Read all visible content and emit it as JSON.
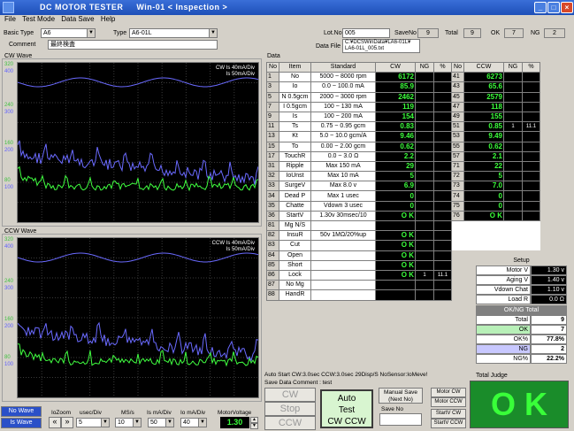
{
  "window": {
    "title": "DC MOTOR TESTER",
    "subtitle": "Win-01 < Inspection >"
  },
  "menu": [
    "File",
    "Test Mode",
    "Data Save",
    "Help"
  ],
  "header": {
    "basic_type_label": "Basic Type",
    "basic_type": "A6",
    "type_label": "Type",
    "type": "A6-01L",
    "comment_label": "Comment",
    "comment": "最終検査",
    "lotno_label": "Lot.No",
    "lotno": "005",
    "saveno_label": "SaveNo",
    "saveno": "9",
    "total_label": "Total",
    "total": "9",
    "ok_label": "OK",
    "ok": "7",
    "ng_label": "NG",
    "ng": "2",
    "datafile_label": "Data File",
    "datafile1": "C:¥DCSWinData¥LA6-01L¥",
    "datafile2": "LA6-01L_005.txt"
  },
  "cw_wave": {
    "title": "CW Wave",
    "legend1": "CW Is   40mA/Div",
    "legend2": "Is   50mA/Div",
    "y_labels": [
      "320",
      "400",
      "240",
      "300",
      "160",
      "200",
      "80",
      "100"
    ]
  },
  "ccw_wave": {
    "title": "CCW Wave",
    "legend1": "CCW Is   40mA/Div",
    "legend2": "Is   50mA/Div",
    "y_labels": [
      "320",
      "400",
      "240",
      "300",
      "160",
      "200",
      "80",
      "100"
    ]
  },
  "data_title": "Data",
  "table_headers": [
    "No",
    "Item",
    "Standard",
    "CW",
    "NG",
    "%",
    "No",
    "CCW",
    "NG",
    "%"
  ],
  "rows": [
    {
      "no": "1",
      "item": "No",
      "std": "5000 ~  8000 rpm",
      "cw": "6172",
      "ng": "",
      "pct": "",
      "no2": "41",
      "ccw": "6273",
      "ng2": "",
      "pct2": ""
    },
    {
      "no": "3",
      "item": "Io",
      "std": "0.0 ~ 100.0 mA",
      "cw": "85.9",
      "ng": "",
      "pct": "",
      "no2": "43",
      "ccw": "65.6",
      "ng2": "",
      "pct2": ""
    },
    {
      "no": "5",
      "item": "N 0.5gcm",
      "std": "2000 ~  3000 rpm",
      "cw": "2462",
      "ng": "",
      "pct": "",
      "no2": "45",
      "ccw": "2579",
      "ng2": "",
      "pct2": ""
    },
    {
      "no": "7",
      "item": "I 0.5gcm",
      "std": "100 ~   130 mA",
      "cw": "119",
      "ng": "",
      "pct": "",
      "no2": "47",
      "ccw": "118",
      "ng2": "",
      "pct2": ""
    },
    {
      "no": "9",
      "item": "Is",
      "std": "100 ~   200 mA",
      "cw": "154",
      "ng": "",
      "pct": "",
      "no2": "49",
      "ccw": "155",
      "ng2": "",
      "pct2": ""
    },
    {
      "no": "11",
      "item": "Ts",
      "std": "0.75 ~  0.95 gcm",
      "cw": "0.83",
      "ng": "",
      "pct": "",
      "no2": "51",
      "ccw": "0.85",
      "ng2": "1",
      "pct2": "11.1"
    },
    {
      "no": "13",
      "item": "Kt",
      "std": "5.0 ~  10.0 gcm/A",
      "cw": "9.46",
      "ng": "",
      "pct": "",
      "no2": "53",
      "ccw": "9.49",
      "ng2": "",
      "pct2": ""
    },
    {
      "no": "15",
      "item": "To",
      "std": "0.00 ~  2.00 gcm",
      "cw": "0.62",
      "ng": "",
      "pct": "",
      "no2": "55",
      "ccw": "0.62",
      "ng2": "",
      "pct2": ""
    },
    {
      "no": "17",
      "item": "TouchR",
      "std": "0.0 ~    3.0 Ω",
      "cw": "2.2",
      "ng": "",
      "pct": "",
      "no2": "57",
      "ccw": "2.1",
      "ng2": "",
      "pct2": ""
    },
    {
      "no": "31",
      "item": "Ripple",
      "std": "Max   150 mA",
      "cw": "29",
      "ng": "",
      "pct": "",
      "no2": "71",
      "ccw": "22",
      "ng2": "",
      "pct2": ""
    },
    {
      "no": "32",
      "item": "IoUnst",
      "std": "Max    10 mA",
      "cw": "5",
      "ng": "",
      "pct": "",
      "no2": "72",
      "ccw": "5",
      "ng2": "",
      "pct2": ""
    },
    {
      "no": "33",
      "item": "SurgeV",
      "std": "Max   8.0 v",
      "cw": "6.9",
      "ng": "",
      "pct": "",
      "no2": "73",
      "ccw": "7.0",
      "ng2": "",
      "pct2": ""
    },
    {
      "no": "34",
      "item": "Dead P",
      "std": "Max    1 usec",
      "cw": "0",
      "ng": "",
      "pct": "",
      "no2": "74",
      "ccw": "0",
      "ng2": "",
      "pct2": ""
    },
    {
      "no": "35",
      "item": "Chatte",
      "std": "Vdown    3 usec",
      "cw": "0",
      "ng": "",
      "pct": "",
      "no2": "75",
      "ccw": "0",
      "ng2": "",
      "pct2": ""
    },
    {
      "no": "36",
      "item": "StartV",
      "std": "1.30v 30msec/10",
      "cw": "O K",
      "ng": "",
      "pct": "",
      "no2": "76",
      "ccw": "O K",
      "ng2": "",
      "pct2": ""
    },
    {
      "no": "81",
      "item": "Mg N/S",
      "std": "",
      "cw": "",
      "ng": "",
      "pct": ""
    },
    {
      "no": "82",
      "item": "InsuR",
      "std": "50v 1MΩ/20%up",
      "cw": "O K",
      "ng": "",
      "pct": ""
    },
    {
      "no": "83",
      "item": "Cut",
      "std": "",
      "cw": "O K",
      "ng": "",
      "pct": ""
    },
    {
      "no": "84",
      "item": "Open",
      "std": "",
      "cw": "O K",
      "ng": "",
      "pct": ""
    },
    {
      "no": "85",
      "item": "Short",
      "std": "",
      "cw": "O K",
      "ng": "",
      "pct": ""
    },
    {
      "no": "86",
      "item": "Lock",
      "std": "",
      "cw": "O K",
      "ng": "1",
      "pct": "11.1"
    },
    {
      "no": "87",
      "item": "No Mg",
      "std": "",
      "cw": "",
      "ng": "",
      "pct": ""
    },
    {
      "no": "88",
      "item": "HandR",
      "std": "",
      "cw": "",
      "ng": "",
      "pct": ""
    }
  ],
  "setup": {
    "title": "Setup",
    "items": [
      {
        "k": "Motor V",
        "v": "1.30 v"
      },
      {
        "k": "Aging V",
        "v": "1.40 v"
      },
      {
        "k": "Vdown Chat",
        "v": "1.10 v"
      },
      {
        "k": "Load R",
        "v": "0.0 Ω"
      }
    ]
  },
  "oknghead": "OK/NG Total",
  "totals": [
    {
      "k": "Total",
      "v": "9",
      "c": "#fff"
    },
    {
      "k": "OK",
      "v": "7",
      "c": "#b8f0b8"
    },
    {
      "k": "OK%",
      "v": "77.8%",
      "c": "#fff"
    },
    {
      "k": "NG",
      "v": "2",
      "c": "#c8c8ff"
    },
    {
      "k": "NG%",
      "v": "22.2%",
      "c": "#fff"
    }
  ],
  "status1": "Auto Start CW:3.0sec CCW:3.0sec 29Disp/S NoSensor:IoMeve!",
  "status2": "Save Data Comment : test",
  "buttons": {
    "cw": "CW",
    "stop": "Stop",
    "ccw": "CCW",
    "auto1": "Auto",
    "auto2": "Test",
    "auto3": "CW CCW",
    "manual1": "Manual Save",
    "manual2": "(Next No)",
    "saveno_label": "Save No",
    "motor_cw": "Motor  CW",
    "motor_ccw": "Motor CCW",
    "startv_cw": "StartV  CW",
    "startv_ccw": "StartV CCW"
  },
  "judge": {
    "title": "Total Judge",
    "value": "O K"
  },
  "bottom": {
    "no_wave": "No Wave",
    "is_wave": "Is Wave",
    "iozoom": "IoZoom",
    "usec_div": "usec/Div",
    "usec_val": "5",
    "ms_s": "MS/s",
    "ms_val": "10",
    "is_ma": "Is mA/Div",
    "is_val": "50",
    "io_ma": "Io mA/Div",
    "io_val": "40",
    "motorv": "MotorVoltage",
    "motorv_val": "1.30"
  }
}
